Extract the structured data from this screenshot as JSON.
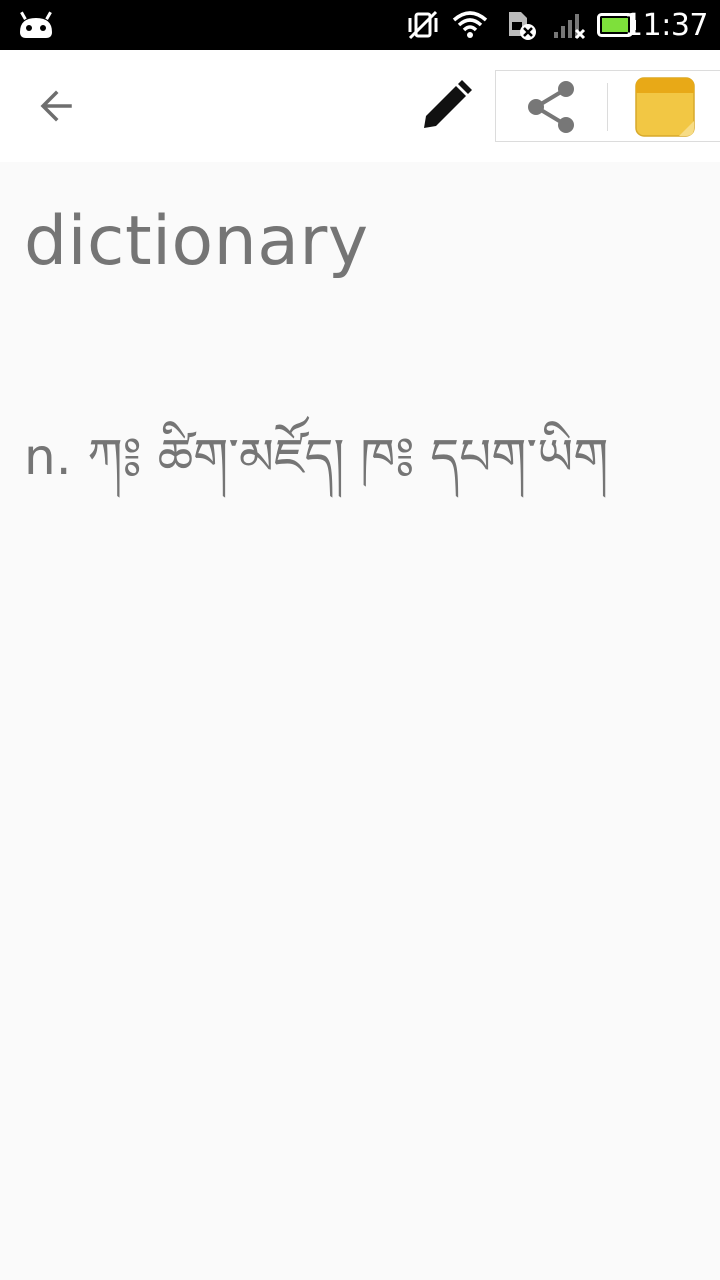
{
  "status_bar": {
    "time": "11:37",
    "icons": [
      "android-notification-icon",
      "vibrate-off-icon",
      "wifi-icon",
      "sim-error-icon",
      "signal-no-service-icon",
      "battery-icon"
    ],
    "battery_color": "#7ee03b"
  },
  "toolbar": {
    "back_icon": "arrow-back-icon",
    "edit_icon": "pencil-icon",
    "share_icon": "share-icon",
    "notes_icon": "sticky-note-icon",
    "notes_color": "#f2c744"
  },
  "entry": {
    "word": "dictionary",
    "definition": "n. ཀ༔ ཚིག་མཛོད། ཁ༔ དཔག་ཡིག"
  },
  "colors": {
    "background": "#fafafa",
    "toolbar": "#ffffff",
    "text": "#757575"
  }
}
